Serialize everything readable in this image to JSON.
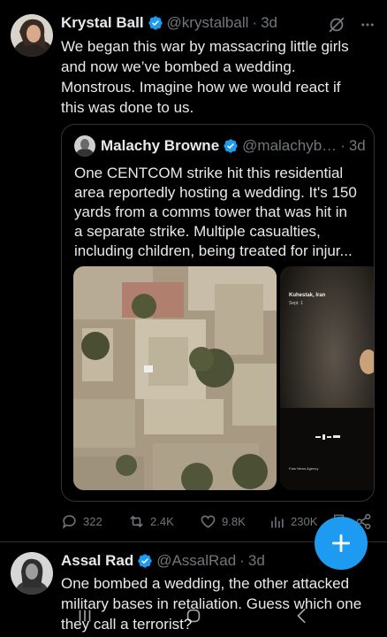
{
  "tweet1": {
    "name": "Krystal Ball",
    "handle": "@krystalball",
    "time": "3d",
    "text_lines": [
      "We began this war by massacring little girls",
      "and now we’ve bombed a wedding.",
      "Monstrous. Imagine how we would react if",
      "this was done to us."
    ]
  },
  "quote": {
    "name": "Malachy Browne",
    "handle": "@malachyb…",
    "time": "3d",
    "text_lines": [
      "One CENTCOM strike hit this residential",
      "area reportedly hosting a wedding. It's 150",
      "yards from a comms tower that was hit in",
      "a separate strike. Multiple casualties,",
      "including children, being treated for injur..."
    ],
    "media2": {
      "location": "Kuhestak, Iran",
      "date": "Sept. 1",
      "credit": "Fars News Agency"
    }
  },
  "actions": {
    "replies": "322",
    "reposts": "2.4K",
    "likes": "9.8K",
    "views": "230K"
  },
  "tweet2": {
    "name": "Assal Rad",
    "handle": "@AssalRad",
    "time": "3d",
    "text_lines": [
      "One bombed a wedding, the other attacked",
      "military bases in retaliation. Guess which one",
      "they call a terrorist?"
    ]
  },
  "colors": {
    "accent": "#1d9bf0",
    "muted": "#71767b",
    "background": "#000000"
  }
}
